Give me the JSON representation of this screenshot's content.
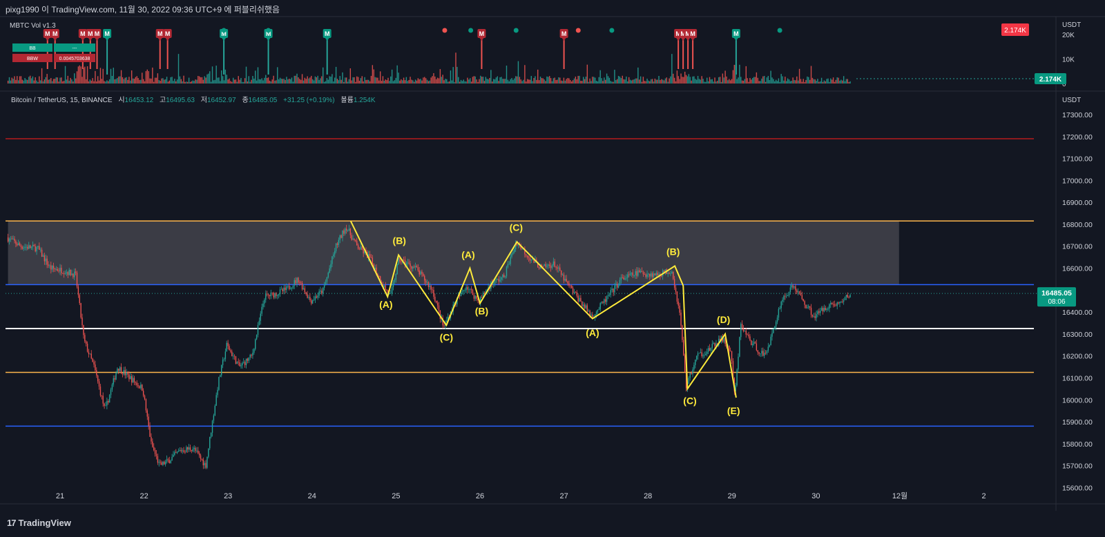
{
  "header": {
    "text": "pixg1990 이 TradingView.com, 11월 30, 2022 09:36 UTC+9 에 퍼블리쉬했음"
  },
  "footer": {
    "brand": "TradingView",
    "mark": "17"
  },
  "colors": {
    "up": "#26a69a",
    "down": "#ef5350",
    "bg": "#131722",
    "grid": "#1e222d",
    "wave": "#ffeb3b",
    "zone": "#4a4a52",
    "red_line": "#b71c1c",
    "orange_line": "#ffb74d",
    "blue_line": "#2962ff",
    "white_line": "#ffffff",
    "last_price_bg": "#089981",
    "vol_last_bg": "#089981"
  },
  "volume_pane": {
    "title": "MBTC Vol v1.3",
    "currency": "USDT",
    "badge_value": "2.174K",
    "last_value": "2.174K",
    "ticks": [
      "20K",
      "10K",
      "0"
    ],
    "tick_values": [
      20000,
      10000,
      0
    ],
    "table": {
      "rows": [
        {
          "label": "BB",
          "value": "---"
        },
        {
          "label": "BBW",
          "value": "0.0045703638"
        }
      ]
    },
    "marker_letter": "M",
    "markers": [
      {
        "day": 20.85,
        "side": "down"
      },
      {
        "day": 20.94,
        "side": "down"
      },
      {
        "day": 21.27,
        "side": "down"
      },
      {
        "day": 21.36,
        "side": "down"
      },
      {
        "day": 21.44,
        "side": "down"
      },
      {
        "day": 21.56,
        "side": "up"
      },
      {
        "day": 22.19,
        "side": "down"
      },
      {
        "day": 22.28,
        "side": "down"
      },
      {
        "day": 22.95,
        "side": "up"
      },
      {
        "day": 23.48,
        "side": "up"
      },
      {
        "day": 24.18,
        "side": "up"
      },
      {
        "day": 26.02,
        "side": "down"
      },
      {
        "day": 27.0,
        "side": "down"
      },
      {
        "day": 29.05,
        "side": "up"
      }
    ],
    "cluster_markers": [
      {
        "day": 28.46,
        "side": "down",
        "count": 4
      }
    ],
    "dots": [
      {
        "day": 22.95,
        "side": "up"
      },
      {
        "day": 23.48,
        "side": "up"
      },
      {
        "day": 25.58,
        "side": "down"
      },
      {
        "day": 25.89,
        "side": "up"
      },
      {
        "day": 26.43,
        "side": "up"
      },
      {
        "day": 27.17,
        "side": "down"
      },
      {
        "day": 27.57,
        "side": "up"
      },
      {
        "day": 29.57,
        "side": "up"
      }
    ]
  },
  "price_pane": {
    "legend": {
      "symbol": "Bitcoin / TetherUS, 15, BINANCE",
      "o_label": "시",
      "o": "16453.12",
      "h_label": "고",
      "h": "16495.63",
      "l_label": "저",
      "l": "16452.97",
      "c_label": "종",
      "c": "16485.05",
      "chg": "+31.25 (+0.19%)",
      "vol_label": "볼륨",
      "vol": "1.254K"
    },
    "currency": "USDT",
    "last_price": "16485.05",
    "countdown": "08:06",
    "y_ticks": [
      "17300.00",
      "17200.00",
      "17100.00",
      "17000.00",
      "16900.00",
      "16800.00",
      "16700.00",
      "16600.00",
      "16500.00",
      "16400.00",
      "16300.00",
      "16200.00",
      "16100.00",
      "16000.00",
      "15900.00",
      "15800.00",
      "15700.00",
      "15600.00"
    ]
  },
  "time_axis": {
    "labels": [
      "21",
      "22",
      "23",
      "24",
      "25",
      "26",
      "27",
      "28",
      "29",
      "30",
      "12월",
      "2"
    ]
  },
  "chart_data": {
    "type": "candlestick",
    "title": "Bitcoin / TetherUS, 15, BINANCE",
    "ylabel": "USDT",
    "ylim": [
      15575,
      17365
    ],
    "x_axis": "day of month (Nov-Dec 2022)",
    "xlim": [
      20.38,
      32.5
    ],
    "grid": false,
    "price_path": {
      "note_free": true,
      "days": [
        20.38,
        20.55,
        20.75,
        20.9,
        21.05,
        21.2,
        21.3,
        21.42,
        21.55,
        21.7,
        21.85,
        22.0,
        22.1,
        22.2,
        22.3,
        22.45,
        22.6,
        22.75,
        22.9,
        23.0,
        23.15,
        23.3,
        23.45,
        23.55,
        23.7,
        23.85,
        24.0,
        24.15,
        24.3,
        24.42,
        24.55,
        24.7,
        24.85,
        24.95,
        25.05,
        25.25,
        25.45,
        25.58,
        25.7,
        25.85,
        26.0,
        26.15,
        26.3,
        26.45,
        26.6,
        26.75,
        26.9,
        27.05,
        27.15,
        27.35,
        27.5,
        27.7,
        27.9,
        28.1,
        28.3,
        28.4,
        28.47,
        28.6,
        28.75,
        28.9,
        29.0,
        29.05,
        29.12,
        29.25,
        29.4,
        29.5,
        29.6,
        29.75,
        29.9,
        30.0,
        30.15,
        30.3,
        30.42
      ],
      "prices": [
        16740,
        16700,
        16690,
        16600,
        16590,
        16570,
        16270,
        16150,
        15950,
        16150,
        16100,
        16050,
        15800,
        15700,
        15720,
        15770,
        15780,
        15700,
        16080,
        16250,
        16150,
        16200,
        16470,
        16480,
        16500,
        16550,
        16450,
        16500,
        16700,
        16790,
        16700,
        16650,
        16530,
        16470,
        16640,
        16600,
        16500,
        16330,
        16430,
        16520,
        16450,
        16530,
        16560,
        16720,
        16650,
        16600,
        16620,
        16530,
        16480,
        16380,
        16450,
        16550,
        16580,
        16570,
        16590,
        16380,
        16060,
        16200,
        16230,
        16280,
        16220,
        16010,
        16340,
        16260,
        16200,
        16300,
        16450,
        16520,
        16430,
        16380,
        16430,
        16440,
        16480
      ]
    },
    "horizontal_lines": [
      {
        "price": 17190,
        "color": "red"
      },
      {
        "price": 16815,
        "color": "orange"
      },
      {
        "price": 16525,
        "color": "blue"
      },
      {
        "price": 16325,
        "color": "white"
      },
      {
        "price": 16125,
        "color": "orange"
      },
      {
        "price": 15880,
        "color": "blue"
      }
    ],
    "zone": {
      "from_day": 20.38,
      "to_day": 30.99,
      "top": 16815,
      "bottom": 16525
    },
    "wave_lines": [
      {
        "points": [
          [
            24.46,
            16815
          ],
          [
            24.9,
            16470
          ],
          [
            25.03,
            16660
          ],
          [
            25.6,
            16340
          ],
          [
            25.88,
            16600
          ],
          [
            26.0,
            16440
          ],
          [
            26.44,
            16720
          ],
          [
            27.34,
            16370
          ],
          [
            28.32,
            16610
          ],
          [
            28.42,
            16520
          ],
          [
            28.47,
            16050
          ],
          [
            28.92,
            16300
          ],
          [
            29.05,
            16010
          ]
        ]
      }
    ],
    "wave_labels": [
      {
        "text": "(A)",
        "day": 24.88,
        "price": 16420
      },
      {
        "text": "(B)",
        "day": 25.04,
        "price": 16710
      },
      {
        "text": "(C)",
        "day": 25.6,
        "price": 16270
      },
      {
        "text": "(A)",
        "day": 25.86,
        "price": 16645
      },
      {
        "text": "(B)",
        "day": 26.02,
        "price": 16390
      },
      {
        "text": "(C)",
        "day": 26.43,
        "price": 16770
      },
      {
        "text": "(A)",
        "day": 27.34,
        "price": 16290
      },
      {
        "text": "(B)",
        "day": 28.3,
        "price": 16660
      },
      {
        "text": "(C)",
        "day": 28.5,
        "price": 15980
      },
      {
        "text": "(D)",
        "day": 28.9,
        "price": 16350
      },
      {
        "text": "(E)",
        "day": 29.02,
        "price": 15935
      }
    ]
  }
}
